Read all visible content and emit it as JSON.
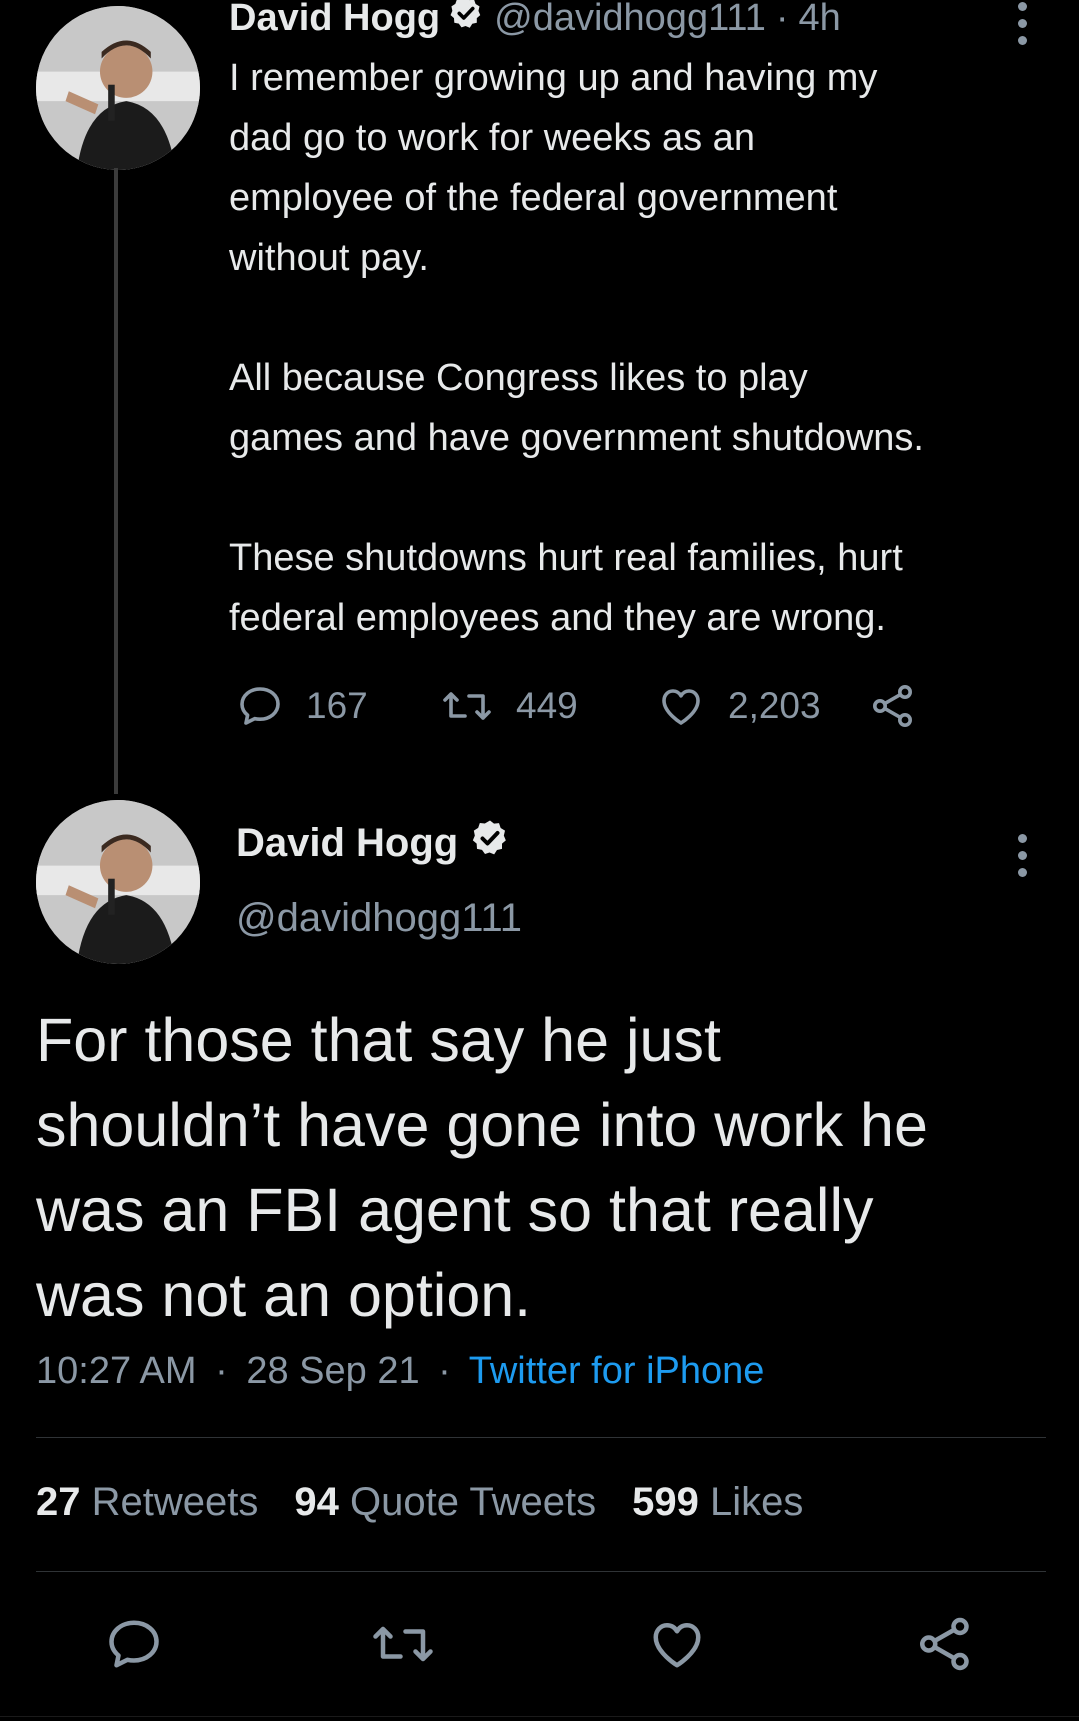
{
  "parent_tweet": {
    "author_name": "David Hogg",
    "handle": "@davidhogg111",
    "separator": "·",
    "time_ago": "4h",
    "text": "I remember growing up and having my\ndad go to work for weeks as an\nemployee of the federal government\nwithout pay.\n\nAll because Congress likes to play\ngames and have government shutdowns.\n\nThese shutdowns hurt real families, hurt\nfederal employees and they are wrong.",
    "replies": "167",
    "retweets": "449",
    "likes": "2,203"
  },
  "main_tweet": {
    "author_name": "David Hogg",
    "handle": "@davidhogg111",
    "text": "For those that say he just\nshouldn’t have gone into work he\nwas an FBI agent so that really\nwas not an option.",
    "time": "10:27 AM",
    "separator": "·",
    "date": "28 Sep 21",
    "source": "Twitter for iPhone",
    "stats": {
      "retweets_count": "27",
      "retweets_label": "Retweets",
      "quotes_count": "94",
      "quotes_label": "Quote Tweets",
      "likes_count": "599",
      "likes_label": "Likes"
    }
  },
  "icons": {
    "reply": "reply-icon",
    "retweet": "retweet-icon",
    "like": "heart-icon",
    "share": "share-icon",
    "more": "more-options-icon",
    "verified": "verified-badge-icon"
  },
  "colors": {
    "background": "#000000",
    "text": "#e7e9ea",
    "muted": "#8b98a5",
    "link": "#1d9bf0",
    "divider": "#2f3336"
  }
}
